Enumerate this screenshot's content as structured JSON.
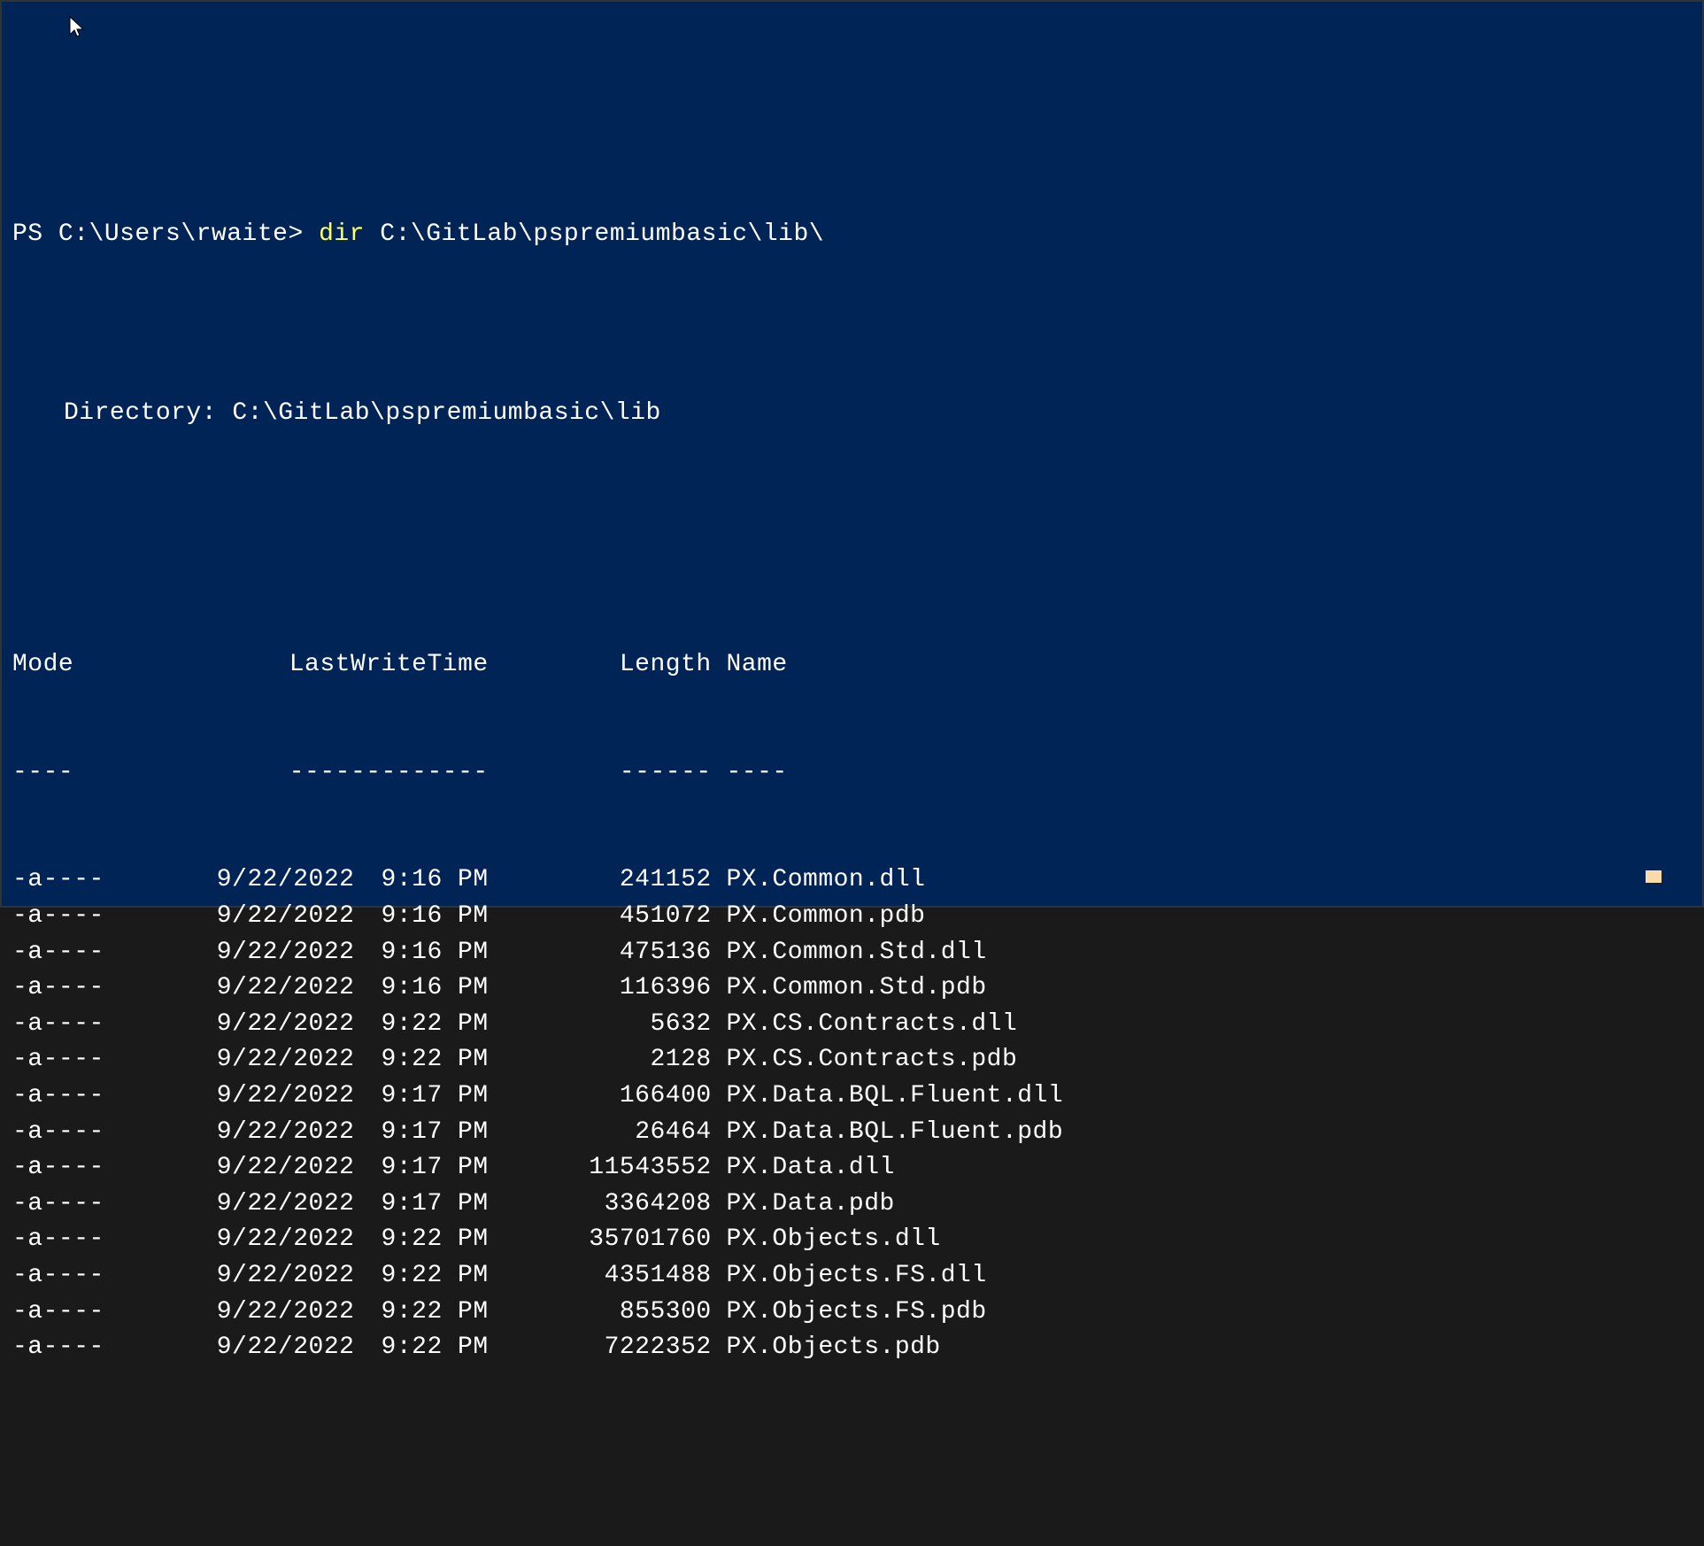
{
  "prompt": {
    "prefix": "PS C:\\Users\\rwaite> ",
    "command": "dir",
    "argument": " C:\\GitLab\\pspremiumbasic\\lib\\"
  },
  "directory_header": {
    "label": "Directory: ",
    "path": "C:\\GitLab\\pspremiumbasic\\lib"
  },
  "columns": {
    "mode": "Mode",
    "last_write_time": "LastWriteTime",
    "length": "Length",
    "name": "Name"
  },
  "dividers": {
    "mode": "----",
    "last_write_time": "-------------",
    "length": "------",
    "name": "----"
  },
  "rows": [
    {
      "mode": "-a----",
      "date": "9/22/2022",
      "time": "9:16 PM",
      "length": "241152",
      "name": "PX.Common.dll"
    },
    {
      "mode": "-a----",
      "date": "9/22/2022",
      "time": "9:16 PM",
      "length": "451072",
      "name": "PX.Common.pdb"
    },
    {
      "mode": "-a----",
      "date": "9/22/2022",
      "time": "9:16 PM",
      "length": "475136",
      "name": "PX.Common.Std.dll"
    },
    {
      "mode": "-a----",
      "date": "9/22/2022",
      "time": "9:16 PM",
      "length": "116396",
      "name": "PX.Common.Std.pdb"
    },
    {
      "mode": "-a----",
      "date": "9/22/2022",
      "time": "9:22 PM",
      "length": "5632",
      "name": "PX.CS.Contracts.dll"
    },
    {
      "mode": "-a----",
      "date": "9/22/2022",
      "time": "9:22 PM",
      "length": "2128",
      "name": "PX.CS.Contracts.pdb"
    },
    {
      "mode": "-a----",
      "date": "9/22/2022",
      "time": "9:17 PM",
      "length": "166400",
      "name": "PX.Data.BQL.Fluent.dll"
    },
    {
      "mode": "-a----",
      "date": "9/22/2022",
      "time": "9:17 PM",
      "length": "26464",
      "name": "PX.Data.BQL.Fluent.pdb"
    },
    {
      "mode": "-a----",
      "date": "9/22/2022",
      "time": "9:17 PM",
      "length": "11543552",
      "name": "PX.Data.dll"
    },
    {
      "mode": "-a----",
      "date": "9/22/2022",
      "time": "9:17 PM",
      "length": "3364208",
      "name": "PX.Data.pdb"
    },
    {
      "mode": "-a----",
      "date": "9/22/2022",
      "time": "9:22 PM",
      "length": "35701760",
      "name": "PX.Objects.dll"
    },
    {
      "mode": "-a----",
      "date": "9/22/2022",
      "time": "9:22 PM",
      "length": "4351488",
      "name": "PX.Objects.FS.dll"
    },
    {
      "mode": "-a----",
      "date": "9/22/2022",
      "time": "9:22 PM",
      "length": "855300",
      "name": "PX.Objects.FS.pdb"
    },
    {
      "mode": "-a----",
      "date": "9/22/2022",
      "time": "9:22 PM",
      "length": "7222352",
      "name": "PX.Objects.pdb"
    }
  ]
}
